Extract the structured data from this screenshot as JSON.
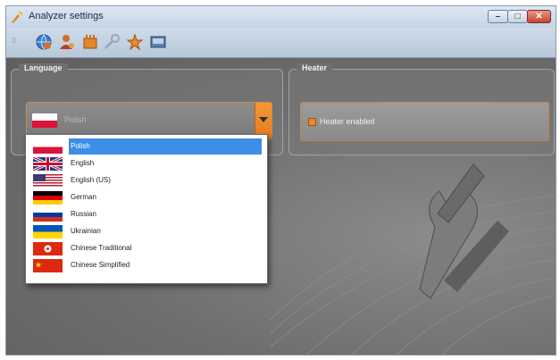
{
  "window": {
    "title": "Analyzer settings",
    "buttons": {
      "minimize": "–",
      "maximize": "□",
      "close": "✕"
    }
  },
  "toolbar": {
    "icons": [
      "globe-settings-icon",
      "user-settings-icon",
      "heater-settings-icon",
      "tools-icon",
      "star-settings-icon",
      "display-icon"
    ]
  },
  "language": {
    "title": "Language",
    "selected": "Polish",
    "options": [
      {
        "label": "Polish",
        "flag": "poland",
        "selected": true
      },
      {
        "label": "English",
        "flag": "uk"
      },
      {
        "label": "English (US)",
        "flag": "usa"
      },
      {
        "label": "German",
        "flag": "germany"
      },
      {
        "label": "Russian",
        "flag": "russia"
      },
      {
        "label": "Ukrainian",
        "flag": "ukraine"
      },
      {
        "label": "Chinese Traditional",
        "flag": "hong-kong"
      },
      {
        "label": "Chinese Simplified",
        "flag": "china"
      }
    ]
  },
  "heater": {
    "title": "Heater",
    "checkbox_label": "Heater enabled",
    "enabled": true
  },
  "colors": {
    "accent": "#f0902a",
    "selection": "#3497f0"
  }
}
